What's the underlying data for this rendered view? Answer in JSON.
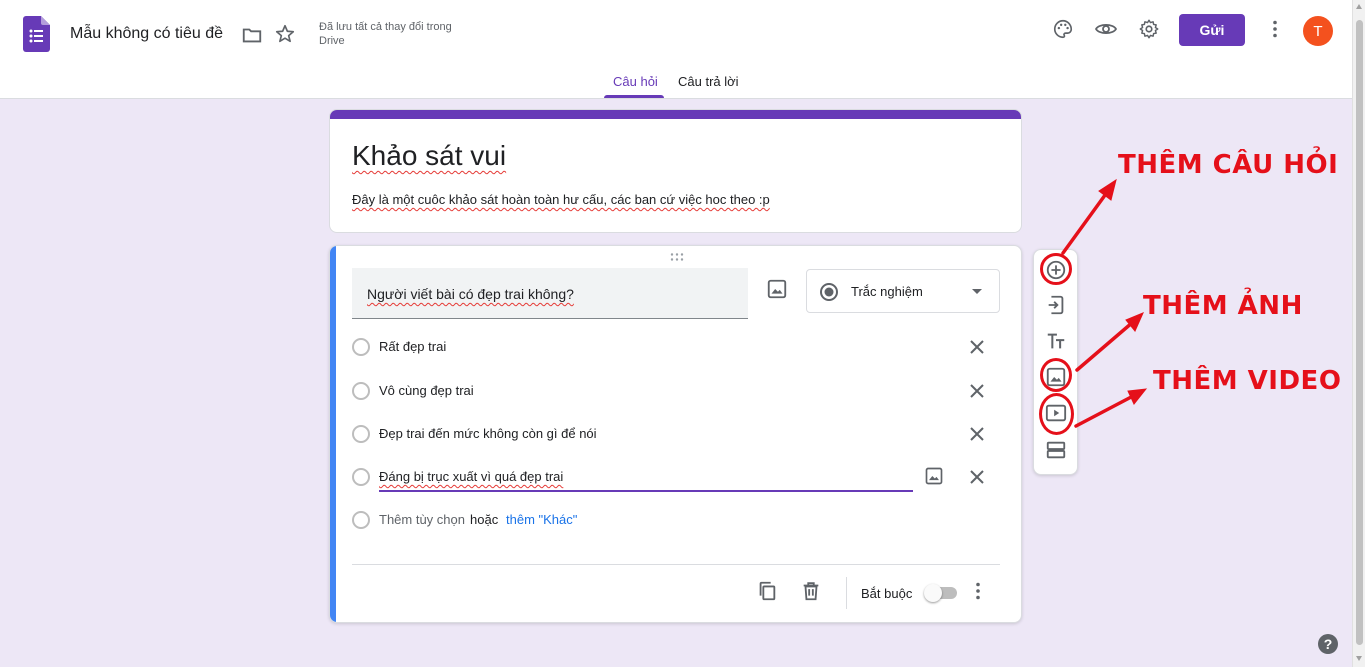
{
  "header": {
    "doc_title": "Mẫu không có tiêu đề",
    "saved_status": "Đã lưu tất cả thay đổi trong Drive",
    "send_label": "Gửi",
    "avatar_letter": "T",
    "accent_color": "#673ab7"
  },
  "tabs": [
    {
      "label": "Câu hỏi",
      "active": true
    },
    {
      "label": "Câu trả lời",
      "active": false
    }
  ],
  "form": {
    "title": "Khảo sát vui",
    "description": "Đây là một cuôc khảo sát hoàn toàn hư cấu, các ban cứ việc hoc theo :p"
  },
  "question": {
    "text": "Người viết bài có đẹp trai không?",
    "type": "Trắc nghiệm",
    "options": [
      "Rất đẹp trai",
      "Vô cùng đẹp trai",
      "Đẹp trai đến mức không còn gì để nói",
      "Đáng bị trục xuất vì quá đẹp trai"
    ],
    "add_option": "Thêm tùy chọn",
    "add_or": "hoặc",
    "add_other": "thêm \"Khác\"",
    "required_label": "Bắt buộc",
    "required": false
  },
  "annotations": {
    "add_question": "THÊM CÂU HỎI",
    "add_image": "THÊM ẢNH",
    "add_video": "THÊM VIDEO",
    "color": "#e5101a"
  },
  "help_glyph": "?"
}
